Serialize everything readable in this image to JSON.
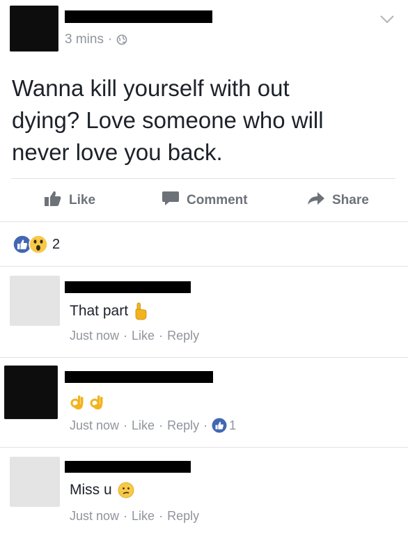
{
  "post": {
    "timestamp": "3 mins",
    "separator": "·",
    "privacy_icon": "globe-icon",
    "options_icon": "chevron-down-icon",
    "text_line1": "Wanna kill yourself with out",
    "text_line2": "dying?  Love someone who will",
    "text_line3": "never love you back."
  },
  "actions": {
    "like_label": "Like",
    "comment_label": "Comment",
    "share_label": "Share"
  },
  "reactions": {
    "icons": [
      "like-reaction-icon",
      "wow-reaction-icon"
    ],
    "count": "2"
  },
  "comments": [
    {
      "text": "That part",
      "emoji": "pointing-up-hand-icon",
      "time": "Just now",
      "like": "Like",
      "reply": "Reply"
    },
    {
      "text": "",
      "emoji": "ok-hand-icon",
      "time": "Just now",
      "like": "Like",
      "reply": "Reply",
      "likes_count": "1"
    },
    {
      "text": "Miss u",
      "emoji": "confused-face-icon",
      "time": "Just now",
      "like": "Like",
      "reply": "Reply"
    }
  ],
  "colors": {
    "like_blue": "#4267b2",
    "meta_gray": "#90949c",
    "action_gray": "#6d7178"
  }
}
